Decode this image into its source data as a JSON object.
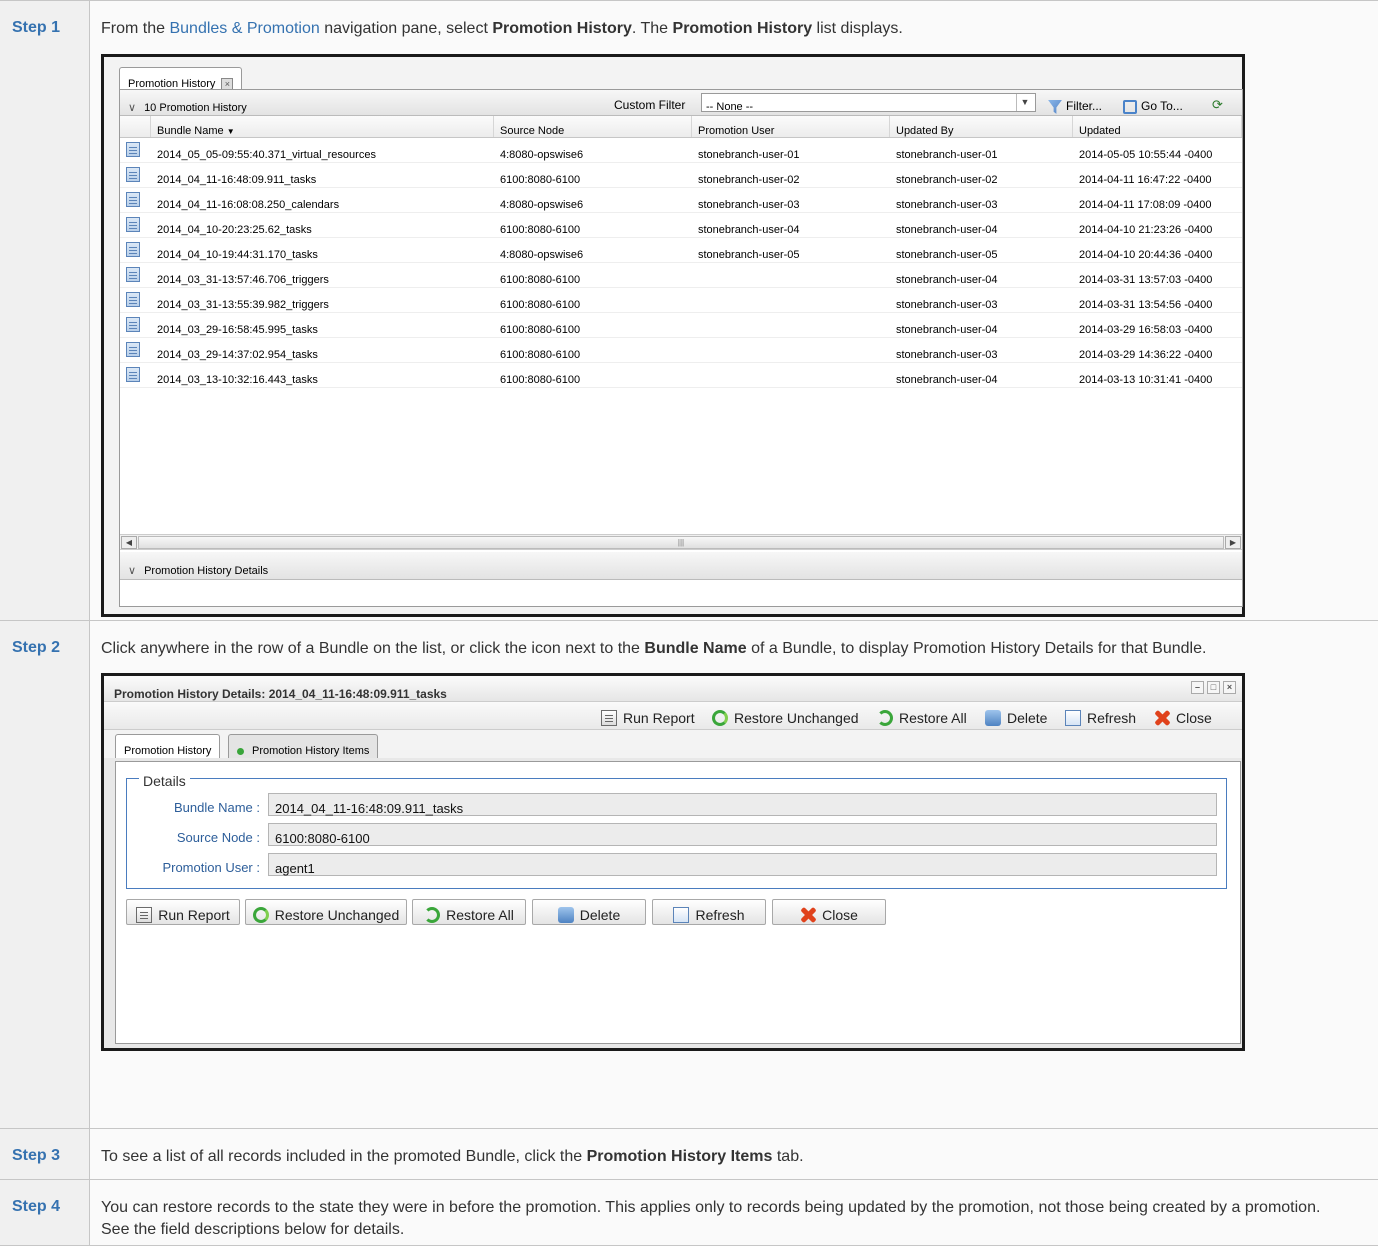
{
  "steps": [
    {
      "label": "Step 1",
      "text_before": "From the ",
      "link": "Bundles & Promotion",
      "text_mid1": " navigation pane, select ",
      "bold1": "Promotion History",
      "text_mid2": ". The ",
      "bold2": "Promotion History",
      "text_after": " list displays."
    },
    {
      "label": "Step 2",
      "text_before": "Click anywhere in the row of a Bundle on the list, or click the icon next to the ",
      "bold1": "Bundle Name",
      "text_after": " of a Bundle, to display Promotion History Details for that Bundle."
    },
    {
      "label": "Step 3",
      "text_before": "To see a list of all records included in the promoted Bundle, click the ",
      "bold1": "Promotion History Items",
      "text_after": " tab."
    },
    {
      "label": "Step 4",
      "text": "You can restore records to the state they were in before the promotion. This applies only to records being updated by the promotion, not those being created by a promotion. See the field descriptions below for details."
    }
  ],
  "list_window": {
    "tab_label": "Promotion History",
    "list_title": "10 Promotion History",
    "custom_filter_label": "Custom Filter",
    "custom_filter_value": "-- None --",
    "filter_button": "Filter...",
    "goto_button": "Go To...",
    "columns": [
      "Bundle Name",
      "Source Node",
      "Promotion User",
      "Updated By",
      "Updated"
    ],
    "rows": [
      [
        "2014_05_05-09:55:40.371_virtual_resources",
        "4:8080-opswise6",
        "stonebranch-user-01",
        "stonebranch-user-01",
        "2014-05-05 10:55:44 -0400"
      ],
      [
        "2014_04_11-16:48:09.911_tasks",
        "6100:8080-6100",
        "stonebranch-user-02",
        "stonebranch-user-02",
        "2014-04-11 16:47:22 -0400"
      ],
      [
        "2014_04_11-16:08:08.250_calendars",
        "4:8080-opswise6",
        "stonebranch-user-03",
        "stonebranch-user-03",
        "2014-04-11 17:08:09 -0400"
      ],
      [
        "2014_04_10-20:23:25.62_tasks",
        "6100:8080-6100",
        "stonebranch-user-04",
        "stonebranch-user-04",
        "2014-04-10 21:23:26 -0400"
      ],
      [
        "2014_04_10-19:44:31.170_tasks",
        "4:8080-opswise6",
        "stonebranch-user-05",
        "stonebranch-user-05",
        "2014-04-10 20:44:36 -0400"
      ],
      [
        "2014_03_31-13:57:46.706_triggers",
        "6100:8080-6100",
        "",
        "stonebranch-user-04",
        "2014-03-31 13:57:03 -0400"
      ],
      [
        "2014_03_31-13:55:39.982_triggers",
        "6100:8080-6100",
        "",
        "stonebranch-user-03",
        "2014-03-31 13:54:56 -0400"
      ],
      [
        "2014_03_29-16:58:45.995_tasks",
        "6100:8080-6100",
        "",
        "stonebranch-user-04",
        "2014-03-29 16:58:03 -0400"
      ],
      [
        "2014_03_29-14:37:02.954_tasks",
        "6100:8080-6100",
        "",
        "stonebranch-user-03",
        "2014-03-29 14:36:22 -0400"
      ],
      [
        "2014_03_13-10:32:16.443_tasks",
        "6100:8080-6100",
        "",
        "stonebranch-user-04",
        "2014-03-13 10:31:41 -0400"
      ]
    ],
    "details_bar": "Promotion History Details"
  },
  "details_window": {
    "title": "Promotion History Details: 2014_04_11-16:48:09.911_tasks",
    "toolbar": {
      "run_report": "Run Report",
      "restore_unchanged": "Restore Unchanged",
      "restore_all": "Restore All",
      "delete": "Delete",
      "refresh": "Refresh",
      "close": "Close"
    },
    "tabs": [
      "Promotion History",
      "Promotion History Items"
    ],
    "fieldset_legend": "Details",
    "fields": [
      {
        "label": "Bundle Name :",
        "value": "2014_04_11-16:48:09.911_tasks"
      },
      {
        "label": "Source Node :",
        "value": "6100:8080-6100"
      },
      {
        "label": "Promotion User :",
        "value": "agent1"
      }
    ],
    "buttons": {
      "run_report": "Run Report",
      "restore_unchanged": "Restore Unchanged",
      "restore_all": "Restore All",
      "delete": "Delete",
      "refresh": "Refresh",
      "close": "Close"
    }
  }
}
